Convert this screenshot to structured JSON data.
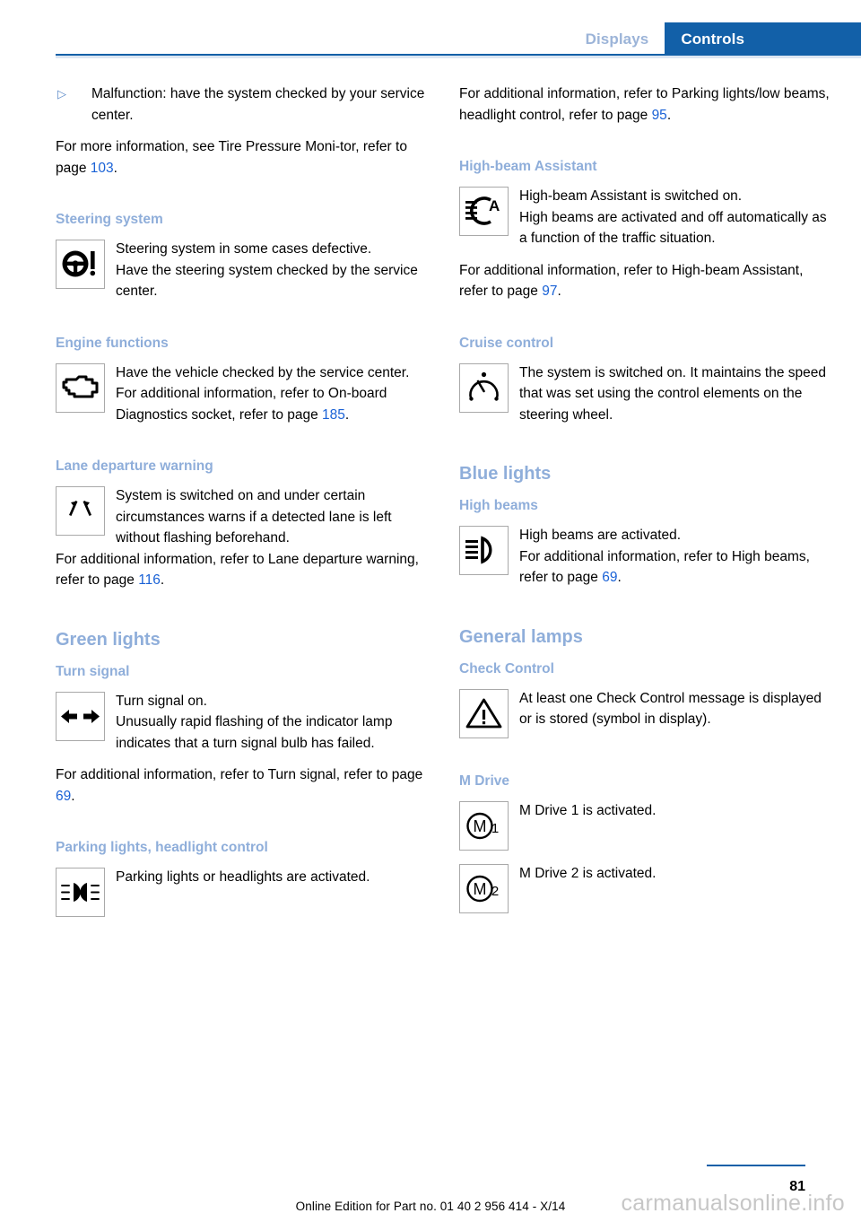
{
  "header": {
    "tab_inactive": "Displays",
    "tab_active": "Controls"
  },
  "colors": {
    "accent_blue": "#1260A8",
    "heading_blue": "#8FAEDA",
    "link_blue": "#1A62D6",
    "inactive_tab": "#9CB4D8"
  },
  "left_column": {
    "bullet": {
      "marker": "▷",
      "text": "Malfunction: have the system checked by your service center."
    },
    "tpms_para": {
      "before": "For more information, see Tire Pressure Moni-tor, refer to page ",
      "page": "103",
      "after": "."
    },
    "steering": {
      "heading": "Steering system",
      "icon": "steering-wheel-warning-icon",
      "text1": "Steering system in some cases defective.",
      "text2": "Have the steering system checked by the service center."
    },
    "engine": {
      "heading": "Engine functions",
      "icon": "engine-check-icon",
      "text1": "Have the vehicle checked by the service center.",
      "text2_before": "For additional information, refer to On-board Diagnostics socket, refer to page ",
      "text2_page": "185",
      "text2_after": "."
    },
    "lane_departure": {
      "heading": "Lane departure warning",
      "icon": "lane-departure-warning-icon",
      "text1": "System is switched on and under certain circumstances warns if a detected lane is left without flashing beforehand.",
      "text2_before": "For additional information, refer to Lane departure warning, refer to page ",
      "text2_page": "116",
      "text2_after": "."
    },
    "green_lights": {
      "heading": "Green lights"
    },
    "turn_signal": {
      "heading": "Turn signal",
      "icon": "turn-signal-arrows-icon",
      "text1": "Turn signal on.",
      "text2": "Unusually rapid flashing of the indicator lamp indicates that a turn signal bulb has failed.",
      "text3_before": "For additional information, refer to Turn signal, refer to page ",
      "text3_page": "69",
      "text3_after": "."
    },
    "parking_lights": {
      "heading": "Parking lights, headlight control",
      "icon": "parking-lights-icon",
      "text1": "Parking lights or headlights are activated."
    }
  },
  "right_column": {
    "parking_ref": {
      "before": "For additional information, refer to Parking lights/low beams, headlight control, refer to page ",
      "page": "95",
      "after": "."
    },
    "high_beam_assistant": {
      "heading": "High-beam Assistant",
      "icon": "high-beam-assistant-icon",
      "text1": "High-beam Assistant is switched on.",
      "text2": "High beams are activated and off automatically as a function of the traffic situation.",
      "text3_before": "For additional information, refer to High-beam Assistant, refer to page ",
      "text3_page": "97",
      "text3_after": "."
    },
    "cruise_control": {
      "heading": "Cruise control",
      "icon": "cruise-control-icon",
      "text1": "The system is switched on. It maintains the speed that was set using the control elements on the steering wheel."
    },
    "blue_lights": {
      "heading": "Blue lights"
    },
    "high_beams": {
      "heading": "High beams",
      "icon": "high-beams-icon",
      "text1": "High beams are activated.",
      "text2_before": "For additional information, refer to High beams, refer to page ",
      "text2_page": "69",
      "text2_after": "."
    },
    "general_lamps": {
      "heading": "General lamps"
    },
    "check_control": {
      "heading": "Check Control",
      "icon": "warning-triangle-icon",
      "text1": "At least one Check Control message is displayed or is stored (symbol in display)."
    },
    "m_drive": {
      "heading": "M Drive",
      "icon1": "m-drive-1-icon",
      "text1": "M Drive 1 is activated.",
      "icon2": "m-drive-2-icon",
      "text2": "M Drive 2 is activated."
    }
  },
  "footer": {
    "edition_text": "Online Edition for Part no. 01 40 2 956 414 - X/14",
    "page_number": "81",
    "watermark": "carmanualsonline.info"
  }
}
